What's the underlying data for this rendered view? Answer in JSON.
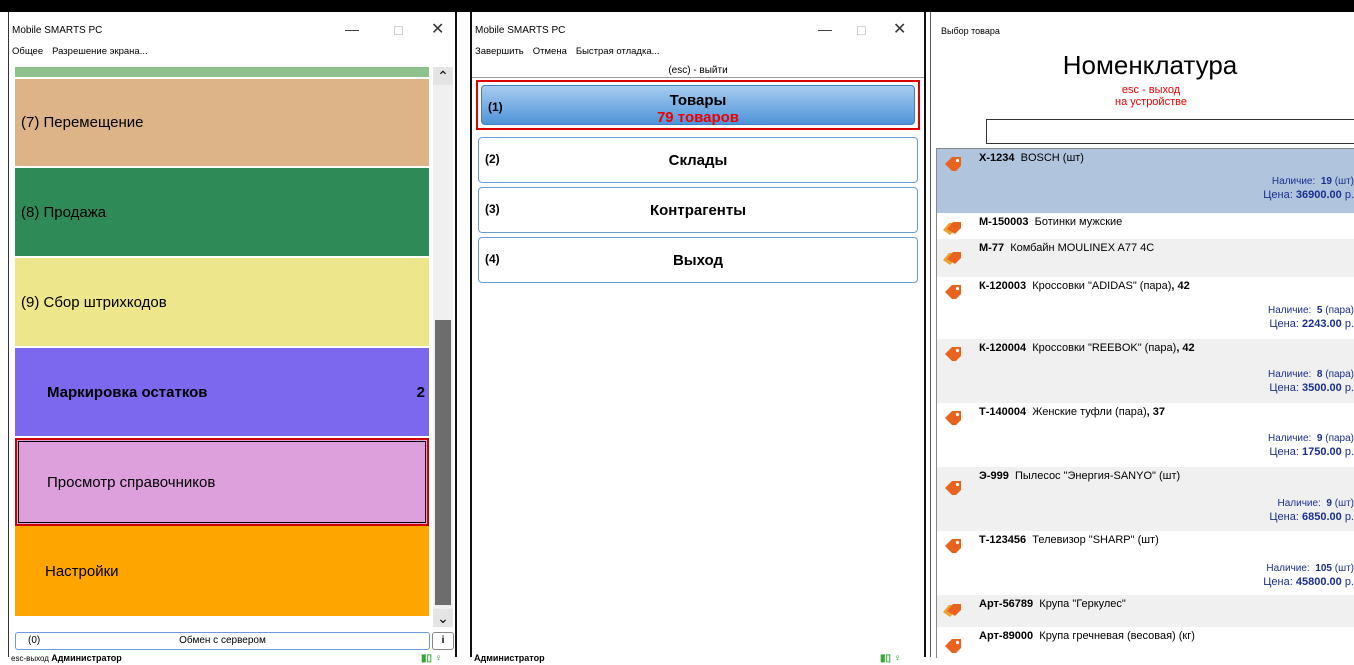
{
  "window1": {
    "title": "Mobile SMARTS PC",
    "menu": [
      "Общее",
      "Разрешение экрана..."
    ],
    "items": [
      {
        "label": "(7) Перемещение"
      },
      {
        "label": "(8) Продажа"
      },
      {
        "label": "(9) Сбор штрихкодов"
      },
      {
        "label": "Маркировка остатков",
        "count": "2"
      },
      {
        "label": "Просмотр справочников"
      },
      {
        "label": "Настройки"
      }
    ],
    "exchange": {
      "num": "(0)",
      "label": "Обмен с сервером"
    },
    "info_btn": "i",
    "status": {
      "esc": "esc-выход",
      "user": "Администратор"
    }
  },
  "window2": {
    "title": "Mobile SMARTS PC",
    "menu": [
      "Завершить",
      "Отмена",
      "Быстрая отладка..."
    ],
    "esc": "(esc) - выйти",
    "buttons": [
      {
        "num": "(1)",
        "label": "Товары",
        "sub": "79 товаров"
      },
      {
        "num": "(2)",
        "label": "Склады"
      },
      {
        "num": "(3)",
        "label": "Контрагенты"
      },
      {
        "num": "(4)",
        "label": "Выход"
      }
    ],
    "status": {
      "user": "Администратор"
    }
  },
  "window3": {
    "title": "Выбор товара",
    "heading": "Номенклатура",
    "esc1": "esc - выход",
    "esc2": "на устройстве",
    "items": [
      {
        "code": "Х-1234",
        "name": "BOSCH (шт)",
        "stock_label": "Наличие:",
        "stock": "19",
        "stock_unit": "(шт)",
        "price_label": "Цена:",
        "price": "36900.00",
        "price_unit": "р."
      },
      {
        "code": "М-150003",
        "name": "Ботинки мужские"
      },
      {
        "code": "М-77",
        "name": "Комбайн MOULINEX A77 4C"
      },
      {
        "code": "К-120003",
        "name": "Кроссовки \"ADIDAS\" (пара)",
        "suffix": ", 42",
        "stock_label": "Наличие:",
        "stock": "5",
        "stock_unit": "(пара)",
        "price_label": "Цена:",
        "price": "2243.00",
        "price_unit": "р."
      },
      {
        "code": "К-120004",
        "name": "Кроссовки \"REEBOK\" (пара)",
        "suffix": ", 42",
        "stock_label": "Наличие:",
        "stock": "8",
        "stock_unit": "(пара)",
        "price_label": "Цена:",
        "price": "3500.00",
        "price_unit": "р."
      },
      {
        "code": "Т-140004",
        "name": "Женские туфли (пара)",
        "suffix": ", 37",
        "stock_label": "Наличие:",
        "stock": "9",
        "stock_unit": "(пара)",
        "price_label": "Цена:",
        "price": "1750.00",
        "price_unit": "р."
      },
      {
        "code": "Э-999",
        "name": "Пылесос \"Энергия-SANYO\" (шт)",
        "stock_label": "Наличие:",
        "stock": "9",
        "stock_unit": "(шт)",
        "price_label": "Цена:",
        "price": "6850.00",
        "price_unit": "р."
      },
      {
        "code": "Т-123456",
        "name": "Телевизор \"SHARP\" (шт)",
        "stock_label": "Наличие:",
        "stock": "105",
        "stock_unit": "(шт)",
        "price_label": "Цена:",
        "price": "45800.00",
        "price_unit": "р."
      },
      {
        "code": "Арт-56789",
        "name": "Крупа \"Геркулес\""
      },
      {
        "code": "Арт-89000",
        "name": "Крупа гречневая (весовая) (кг)"
      }
    ]
  },
  "colors": {
    "accent_red": "#e00000",
    "price_blue": "#1a2f8c",
    "highlight": "#b0c4de",
    "tag_orange": "#e8641e"
  }
}
